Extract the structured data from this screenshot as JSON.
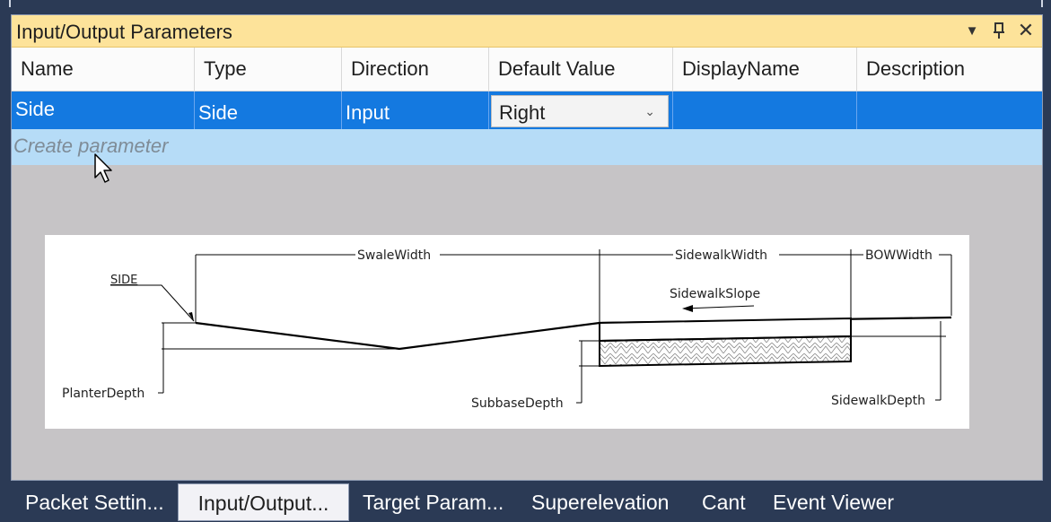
{
  "panel": {
    "title": "Input/Output Parameters",
    "controls": {
      "dropdown": "▼",
      "pin": "ꟼ",
      "close": "✕"
    }
  },
  "grid": {
    "headers": [
      "Name",
      "Type",
      "Direction",
      "Default Value",
      "DisplayName",
      "Description"
    ],
    "row": {
      "name": "Side",
      "type": "Side",
      "direction": "Input",
      "default_value": "Right",
      "display_name": "",
      "description": ""
    },
    "create_placeholder": "Create parameter"
  },
  "diagram": {
    "labels": {
      "side": "SIDE",
      "swale_width": "SwaleWidth",
      "sidewalk_width": "SidewalkWidth",
      "bow_width": "BOWWidth",
      "sidewalk_slope": "SidewalkSlope",
      "planter_depth": "PlanterDepth",
      "subbase_depth": "SubbaseDepth",
      "sidewalk_depth": "SidewalkDepth"
    }
  },
  "tabs": [
    "Packet Settin...",
    "Input/Output...",
    "Target Param...",
    "Superelevation",
    "Cant",
    "Event Viewer"
  ],
  "active_tab": "Input/Output...",
  "colors": {
    "title_bar": "#fde39a",
    "selected_row": "#1479e0",
    "create_row": "#b6dcf7",
    "background": "#2b3a55"
  }
}
